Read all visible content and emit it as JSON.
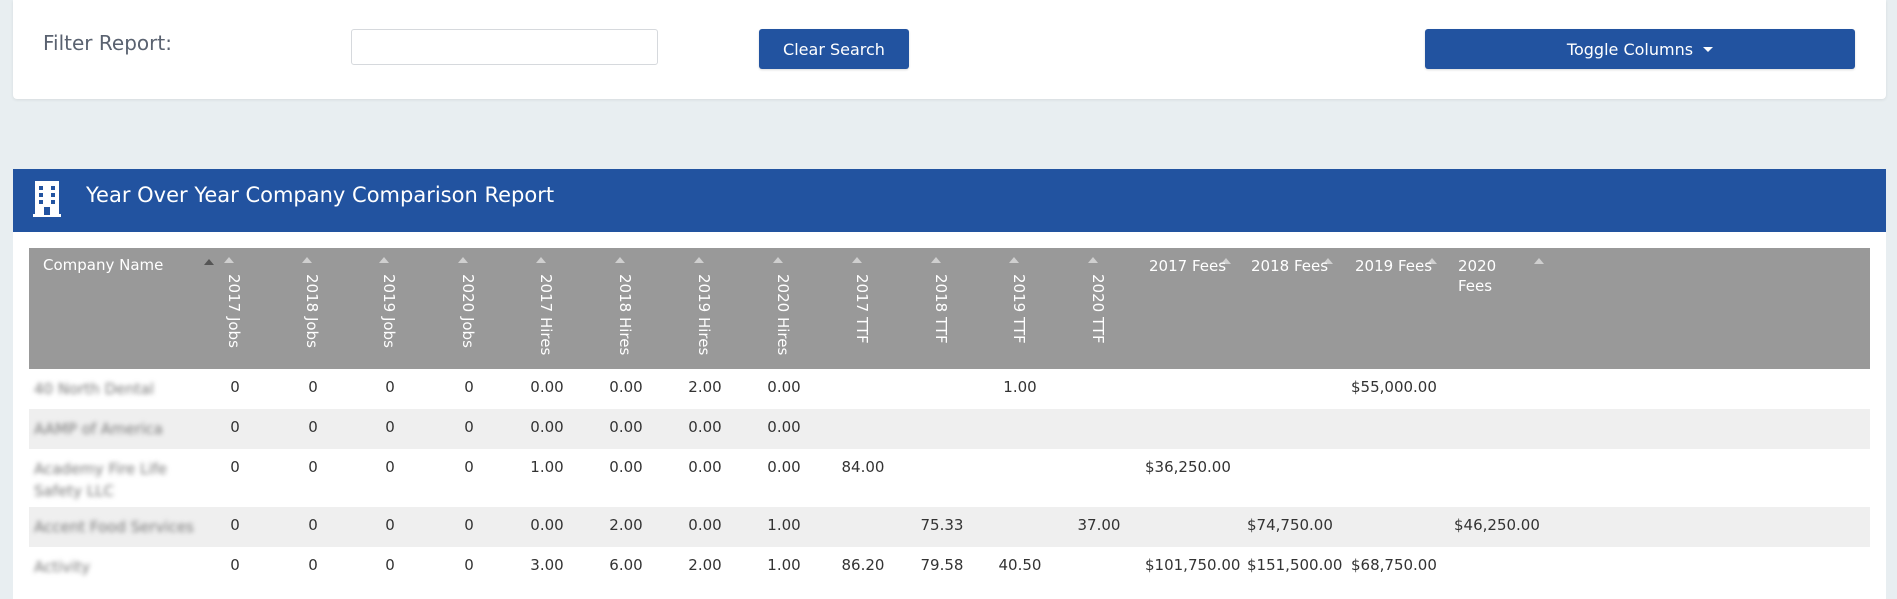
{
  "filter": {
    "label": "Filter Report:",
    "input_value": "",
    "clear_button": "Clear Search",
    "toggle_button": "Toggle Columns"
  },
  "report": {
    "title": "Year Over Year Company Comparison Report",
    "icon": "building-icon",
    "columns": [
      "Company Name",
      "2017 Jobs",
      "2018 Jobs",
      "2019 Jobs",
      "2020 Jobs",
      "2017 Hires",
      "2018 Hires",
      "2019 Hires",
      "2020 Hires",
      "2017 TTF",
      "2018 TTF",
      "2019 TTF",
      "2020 TTF",
      "2017 Fees",
      "2018 Fees",
      "2019 Fees",
      "2020 Fees"
    ],
    "rows": [
      {
        "company": "40 North Dental",
        "j17": "0",
        "j18": "0",
        "j19": "0",
        "j20": "0",
        "h17": "0.00",
        "h18": "0.00",
        "h19": "2.00",
        "h20": "0.00",
        "t17": "",
        "t18": "",
        "t19": "1.00",
        "t20": "",
        "f17": "",
        "f18": "",
        "f19": "$55,000.00",
        "f20": ""
      },
      {
        "company": "AAMP of America",
        "j17": "0",
        "j18": "0",
        "j19": "0",
        "j20": "0",
        "h17": "0.00",
        "h18": "0.00",
        "h19": "0.00",
        "h20": "0.00",
        "t17": "",
        "t18": "",
        "t19": "",
        "t20": "",
        "f17": "",
        "f18": "",
        "f19": "",
        "f20": ""
      },
      {
        "company": "Academy Fire Life Safety LLC",
        "j17": "0",
        "j18": "0",
        "j19": "0",
        "j20": "0",
        "h17": "1.00",
        "h18": "0.00",
        "h19": "0.00",
        "h20": "0.00",
        "t17": "84.00",
        "t18": "",
        "t19": "",
        "t20": "",
        "f17": "$36,250.00",
        "f18": "",
        "f19": "",
        "f20": ""
      },
      {
        "company": "Accent Food Services",
        "j17": "0",
        "j18": "0",
        "j19": "0",
        "j20": "0",
        "h17": "0.00",
        "h18": "2.00",
        "h19": "0.00",
        "h20": "1.00",
        "t17": "",
        "t18": "75.33",
        "t19": "",
        "t20": "37.00",
        "f17": "",
        "f18": "$74,750.00",
        "f19": "",
        "f20": "$46,250.00"
      },
      {
        "company": "Activity",
        "j17": "0",
        "j18": "0",
        "j19": "0",
        "j20": "0",
        "h17": "3.00",
        "h18": "6.00",
        "h19": "2.00",
        "h20": "1.00",
        "t17": "86.20",
        "t18": "79.58",
        "t19": "40.50",
        "t20": "",
        "f17": "$101,750.00",
        "f18": "$151,500.00",
        "f19": "$68,750.00",
        "f20": ""
      }
    ]
  },
  "colors": {
    "primary": "#2253a0",
    "header_gray": "#999999",
    "row_alt": "#efefef",
    "background": "#e8eef1"
  }
}
